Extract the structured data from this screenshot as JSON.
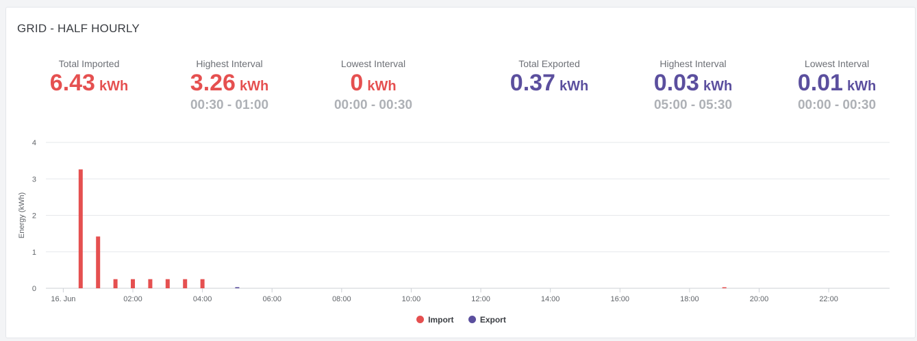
{
  "card": {
    "title": "GRID - HALF HOURLY"
  },
  "stats": {
    "import": {
      "total": {
        "label": "Total Imported",
        "value": "6.43",
        "unit": "kWh"
      },
      "highest": {
        "label": "Highest Interval",
        "value": "3.26",
        "unit": "kWh",
        "time": "00:30 - 01:00"
      },
      "lowest": {
        "label": "Lowest Interval",
        "value": "0",
        "unit": "kWh",
        "time": "00:00 - 00:30"
      }
    },
    "export": {
      "total": {
        "label": "Total Exported",
        "value": "0.37",
        "unit": "kWh"
      },
      "highest": {
        "label": "Highest Interval",
        "value": "0.03",
        "unit": "kWh",
        "time": "05:00 - 05:30"
      },
      "lowest": {
        "label": "Lowest Interval",
        "value": "0.01",
        "unit": "kWh",
        "time": "00:00 - 00:30"
      }
    }
  },
  "colors": {
    "import": "#e55050",
    "export": "#5b4f9e",
    "grid": "#e6e8eb",
    "axis_text": "#5f6368",
    "time_text": "#aeb1b6"
  },
  "chart_data": {
    "type": "bar",
    "title": "",
    "xlabel": "",
    "ylabel": "Energy (kWh)",
    "ylim": [
      0,
      4
    ],
    "y_ticks": [
      0,
      1,
      2,
      3,
      4
    ],
    "x_range_hours": [
      -0.5,
      23.75
    ],
    "x_ticks": [
      {
        "hour": 0,
        "label": "16. Jun"
      },
      {
        "hour": 2,
        "label": "02:00"
      },
      {
        "hour": 4,
        "label": "04:00"
      },
      {
        "hour": 6,
        "label": "06:00"
      },
      {
        "hour": 8,
        "label": "08:00"
      },
      {
        "hour": 10,
        "label": "10:00"
      },
      {
        "hour": 12,
        "label": "12:00"
      },
      {
        "hour": 14,
        "label": "14:00"
      },
      {
        "hour": 16,
        "label": "16:00"
      },
      {
        "hour": 18,
        "label": "18:00"
      },
      {
        "hour": 20,
        "label": "20:00"
      },
      {
        "hour": 22,
        "label": "22:00"
      }
    ],
    "grid": true,
    "legend_position": "bottom-center",
    "series": [
      {
        "name": "Import",
        "color": "#e55050",
        "points": [
          {
            "x": "00:30",
            "hour": 0.5,
            "y": 3.26
          },
          {
            "x": "01:00",
            "hour": 1.0,
            "y": 1.42
          },
          {
            "x": "01:30",
            "hour": 1.5,
            "y": 0.25
          },
          {
            "x": "02:00",
            "hour": 2.0,
            "y": 0.25
          },
          {
            "x": "02:30",
            "hour": 2.5,
            "y": 0.25
          },
          {
            "x": "03:00",
            "hour": 3.0,
            "y": 0.25
          },
          {
            "x": "03:30",
            "hour": 3.5,
            "y": 0.25
          },
          {
            "x": "04:00",
            "hour": 4.0,
            "y": 0.25
          },
          {
            "x": "19:00",
            "hour": 19.0,
            "y": 0.01
          }
        ]
      },
      {
        "name": "Export",
        "color": "#5b4f9e",
        "points": [
          {
            "x": "05:00",
            "hour": 5.0,
            "y": 0.03
          }
        ]
      }
    ]
  }
}
